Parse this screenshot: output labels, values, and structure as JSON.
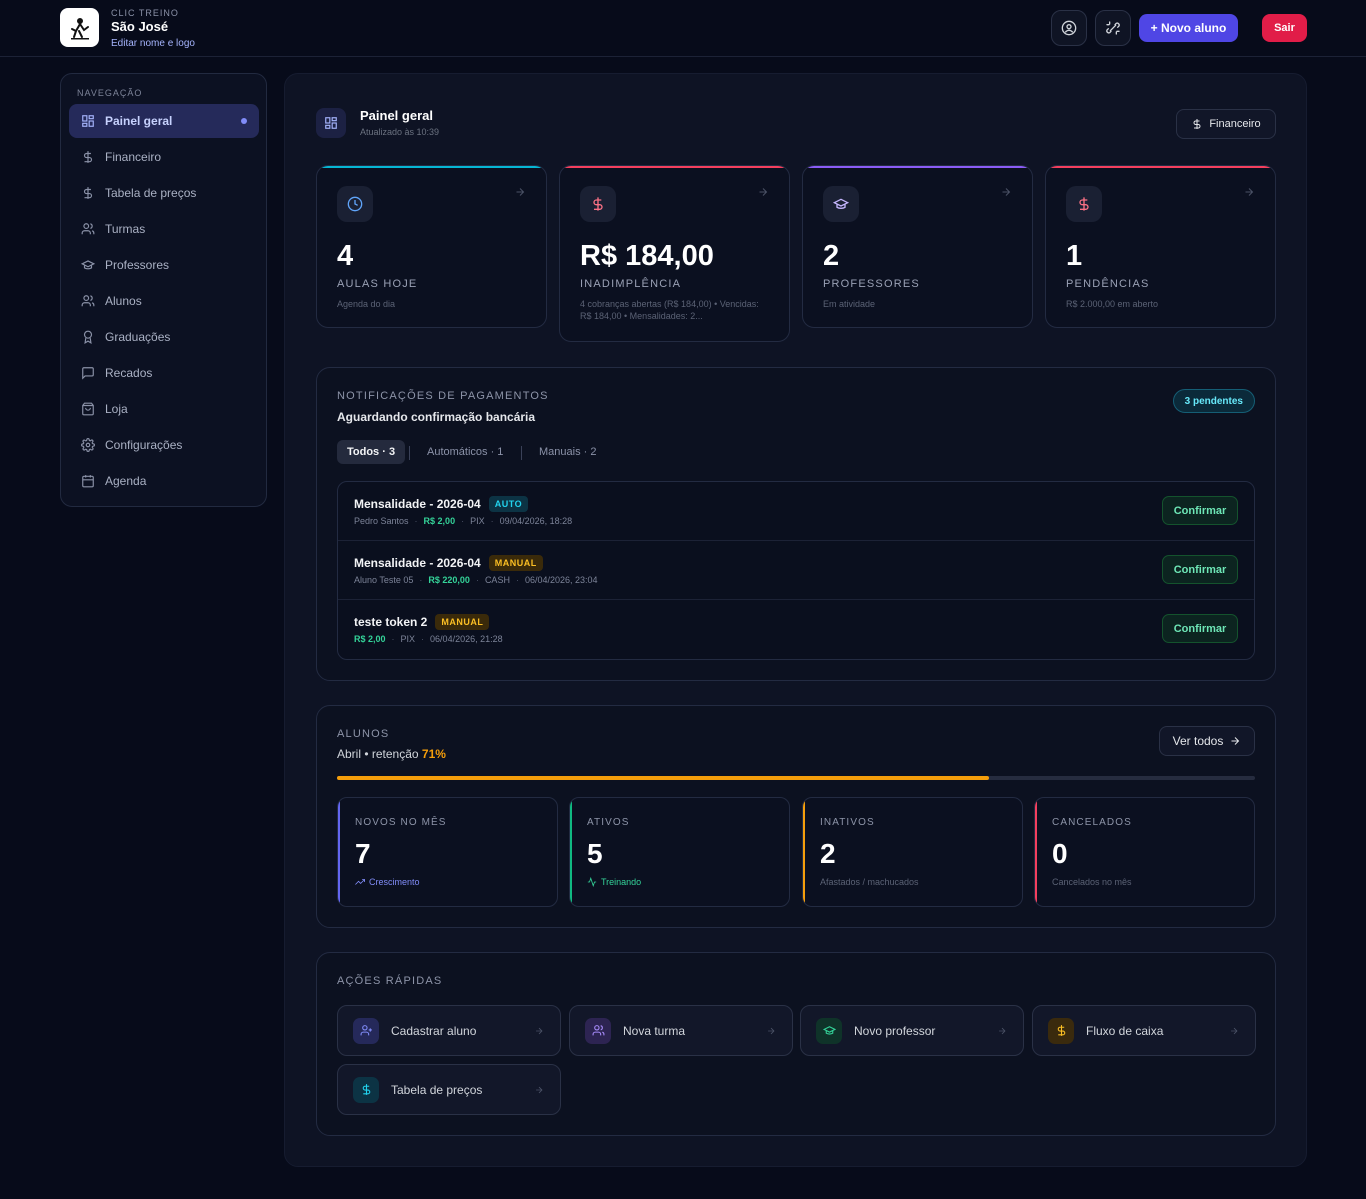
{
  "header": {
    "kicker": "CLIC TREINO",
    "name": "São José",
    "edit_link": "Editar nome e logo",
    "new_student_label": "+ Novo aluno",
    "exit_label": "Sair"
  },
  "sidebar": {
    "heading": "NAVEGAÇÃO",
    "items": [
      {
        "label": "Painel geral",
        "icon": "grid-icon"
      },
      {
        "label": "Financeiro",
        "icon": "dollar-icon"
      },
      {
        "label": "Tabela de preços",
        "icon": "dollar-icon"
      },
      {
        "label": "Turmas",
        "icon": "users-icon"
      },
      {
        "label": "Professores",
        "icon": "graduation-cap-icon"
      },
      {
        "label": "Alunos",
        "icon": "users-icon"
      },
      {
        "label": "Graduações",
        "icon": "award-icon"
      },
      {
        "label": "Recados",
        "icon": "message-icon"
      },
      {
        "label": "Loja",
        "icon": "shopping-bag-icon"
      },
      {
        "label": "Configurações",
        "icon": "gear-icon"
      },
      {
        "label": "Agenda",
        "icon": "calendar-icon"
      }
    ]
  },
  "page": {
    "title": "Painel geral",
    "updated": "Atualizado às 10:39",
    "financeiro_button": "Financeiro"
  },
  "stats": [
    {
      "value": "4",
      "label": "AULAS HOJE",
      "sub": "Agenda do dia",
      "accent": "#06b6d4",
      "icon": "clock-icon"
    },
    {
      "value": "R$ 184,00",
      "label": "INADIMPLÊNCIA",
      "sub": "4 cobranças abertas (R$ 184,00) • Vencidas: R$ 184,00 • Mensalidades: 2...",
      "accent": "#f43f5e",
      "icon": "dollar-icon"
    },
    {
      "value": "2",
      "label": "PROFESSORES",
      "sub": "Em atividade",
      "accent": "#8b5cf6",
      "icon": "graduation-cap-icon"
    },
    {
      "value": "1",
      "label": "PENDÊNCIAS",
      "sub": "R$ 2.000,00 em aberto",
      "accent": "#f43f5e",
      "icon": "dollar-icon"
    }
  ],
  "notifications": {
    "kicker": "NOTIFICAÇÕES DE PAGAMENTOS",
    "title": "Aguardando confirmação bancária",
    "badge": "3 pendentes",
    "tabs": [
      "Todos · 3",
      "Automáticos · 1",
      "Manuais · 2"
    ],
    "confirm_label": "Confirmar",
    "items": [
      {
        "title": "Mensalidade - 2026-04",
        "tag": "AUTO",
        "student": "Pedro Santos",
        "amount": "R$ 2,00",
        "method": "PIX",
        "datetime": "09/04/2026, 18:28"
      },
      {
        "title": "Mensalidade - 2026-04",
        "tag": "MANUAL",
        "student": "Aluno Teste 05",
        "amount": "R$ 220,00",
        "method": "CASH",
        "datetime": "06/04/2026, 23:04"
      },
      {
        "title": "teste token 2",
        "tag": "MANUAL",
        "student": "",
        "amount": "R$ 2,00",
        "method": "PIX",
        "datetime": "06/04/2026, 21:28"
      }
    ]
  },
  "students": {
    "kicker": "ALUNOS",
    "month_text": "Abril • retenção ",
    "retention": "71%",
    "retention_fraction": 0.71,
    "view_all": "Ver todos",
    "cards": [
      {
        "label": "NOVOS NO MÊS",
        "value": "7",
        "sub": "Crescimento",
        "accent": "#6366f1",
        "sub_color": "#818cf8"
      },
      {
        "label": "ATIVOS",
        "value": "5",
        "sub": "Treinando",
        "accent": "#10b981",
        "sub_color": "#34d399"
      },
      {
        "label": "INATIVOS",
        "value": "2",
        "sub": "Afastados / machucados",
        "accent": "#f59e0b",
        "sub_color": "#5b6275"
      },
      {
        "label": "CANCELADOS",
        "value": "0",
        "sub": "Cancelados no mês",
        "accent": "#f43f5e",
        "sub_color": "#5b6275"
      }
    ]
  },
  "quick_actions": {
    "kicker": "AÇÕES RÁPIDAS",
    "items": [
      {
        "label": "Cadastrar aluno",
        "icon": "user-plus-icon",
        "color": "#818cf8",
        "bg": "#25295a"
      },
      {
        "label": "Nova turma",
        "icon": "users-icon",
        "color": "#a78bfa",
        "bg": "#2d2452"
      },
      {
        "label": "Novo professor",
        "icon": "graduation-cap-icon",
        "color": "#34d399",
        "bg": "#0f3329"
      },
      {
        "label": "Fluxo de caixa",
        "icon": "dollar-icon",
        "color": "#fbbf24",
        "bg": "#3a2a0d"
      },
      {
        "label": "Tabela de preços",
        "icon": "dollar-icon",
        "color": "#22d3ee",
        "bg": "#0c3344"
      }
    ]
  }
}
